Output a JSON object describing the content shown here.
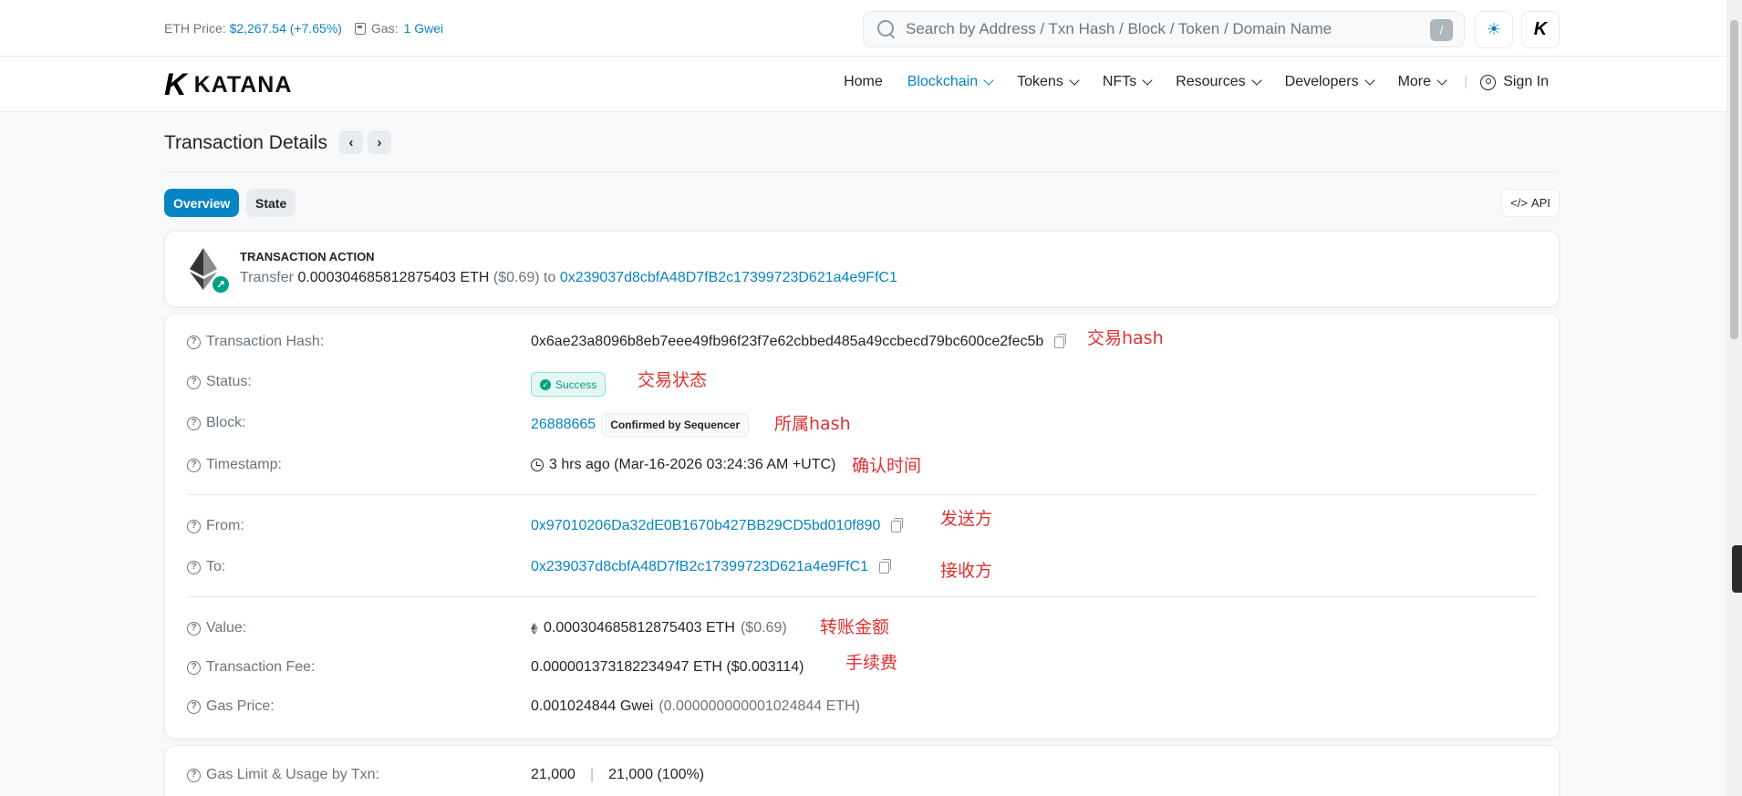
{
  "topbar": {
    "eth_price_label": "ETH Price:",
    "eth_price_value": "$2,267.54 (+7.65%)",
    "gas_label": "Gas:",
    "gas_value": "1 Gwei",
    "search_placeholder": "Search by Address / Txn Hash / Block / Token / Domain Name",
    "search_shortcut": "/"
  },
  "brand": {
    "name": "KATANA",
    "mark": "K"
  },
  "nav": {
    "items": [
      {
        "label": "Home",
        "dropdown": false,
        "active": false
      },
      {
        "label": "Blockchain",
        "dropdown": true,
        "active": true
      },
      {
        "label": "Tokens",
        "dropdown": true,
        "active": false
      },
      {
        "label": "NFTs",
        "dropdown": true,
        "active": false
      },
      {
        "label": "Resources",
        "dropdown": true,
        "active": false
      },
      {
        "label": "Developers",
        "dropdown": true,
        "active": false
      },
      {
        "label": "More",
        "dropdown": true,
        "active": false
      }
    ],
    "sign_in": "Sign In"
  },
  "page": {
    "title": "Transaction Details",
    "tabs": [
      "Overview",
      "State"
    ],
    "api_label": "API"
  },
  "action": {
    "heading": "TRANSACTION ACTION",
    "verb": "Transfer",
    "amount": "0.000304685812875403 ETH",
    "usd": "($0.69)",
    "to_word": "to",
    "to_address": "0x239037d8cbfA48D7fB2c17399723D621a4e9FfC1"
  },
  "details": {
    "hash_label": "Transaction Hash:",
    "hash_value": "0x6ae23a8096b8eb7eee49fb96f23f7e62cbbed485a49ccbecd79bc600ce2fec5b",
    "status_label": "Status:",
    "status_value": "Success",
    "block_label": "Block:",
    "block_value": "26888665",
    "block_badge": "Confirmed by Sequencer",
    "timestamp_label": "Timestamp:",
    "timestamp_value": "3 hrs ago (Mar-16-2026 03:24:36 AM +UTC)",
    "from_label": "From:",
    "from_value": "0x97010206Da32dE0B1670b427BB29CD5bd010f890",
    "to_label": "To:",
    "to_value": "0x239037d8cbfA48D7fB2c17399723D621a4e9FfC1",
    "value_label": "Value:",
    "value_amount": "0.000304685812875403 ETH",
    "value_usd": "($0.69)",
    "fee_label": "Transaction Fee:",
    "fee_value": "0.000001373182234947 ETH ($0.003114)",
    "gas_price_label": "Gas Price:",
    "gas_price_value": "0.001024844 Gwei",
    "gas_price_eth": "(0.000000000001024844 ETH)",
    "gas_limit_label": "Gas Limit & Usage by Txn:",
    "gas_limit_value": "21,000",
    "gas_usage_value": "21,000 (100%)"
  },
  "annotations": {
    "hash": "交易hash",
    "status": "交易状态",
    "block": "所属hash",
    "timestamp": "确认时间",
    "from": "发送方",
    "to": "接收方",
    "value": "转账金额",
    "fee": "手续费"
  },
  "colors": {
    "link": "#0784c3",
    "success": "#00a186",
    "annotation": "#e03131"
  },
  "icons": [
    "search-icon",
    "sun-icon",
    "gas-pump-icon",
    "ethereum-icon",
    "copy-icon",
    "clock-icon",
    "question-icon",
    "user-icon",
    "chevron-down-icon"
  ]
}
